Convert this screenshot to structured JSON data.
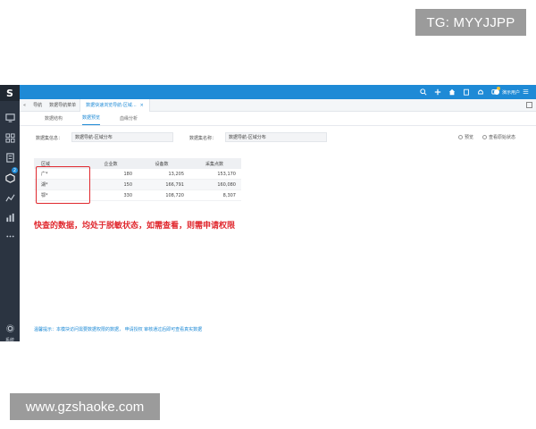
{
  "overlays": {
    "tg_badge": "TG: MYYJJPP",
    "site_badge": "www.gzshaoke.com"
  },
  "sidebar": {
    "logo": "S",
    "icons": [
      "monitor-icon",
      "grid-icon",
      "document-icon",
      "cube-icon",
      "chart-icon",
      "bar-chart-icon",
      "more-icon"
    ],
    "badge_count": "2",
    "bottom_label": "系统"
  },
  "topbar": {
    "icons": [
      "search-icon",
      "plus-icon",
      "home-icon",
      "clipboard-icon",
      "bell-icon",
      "chat-icon"
    ],
    "user_name": "演示用户"
  },
  "tabbar": {
    "crumb_home": "导航",
    "crumb_parent": "数据导航菜单",
    "active_tab": "数据快速浏览导航-区域...",
    "close": "×"
  },
  "subtabs": [
    "数据结构",
    "数据预览",
    "血缘分析"
  ],
  "form": {
    "set_label": "数据集信息：",
    "set_value": "数据导航-区域分布",
    "name_label": "数据集名称：",
    "name_value": "数据导航-区域分布",
    "radio1": "预览",
    "radio2": "查看原始状态"
  },
  "table": {
    "headers": [
      "区域",
      "企业数",
      "设备数",
      "采集点数"
    ],
    "rows": [
      [
        "广*",
        "180",
        "13,205",
        "153,170"
      ],
      [
        "湖*",
        "150",
        "166,791",
        "160,080"
      ],
      [
        "鄂*",
        "330",
        "108,720",
        "8,307"
      ]
    ]
  },
  "notice": "快查的数据，均处于脱敏状态，如需查看，则需申请权限",
  "footnote": "温馨提示：本模块访问需要数据权限的数据，  申请授权  审核通过后即可查看真实数据"
}
